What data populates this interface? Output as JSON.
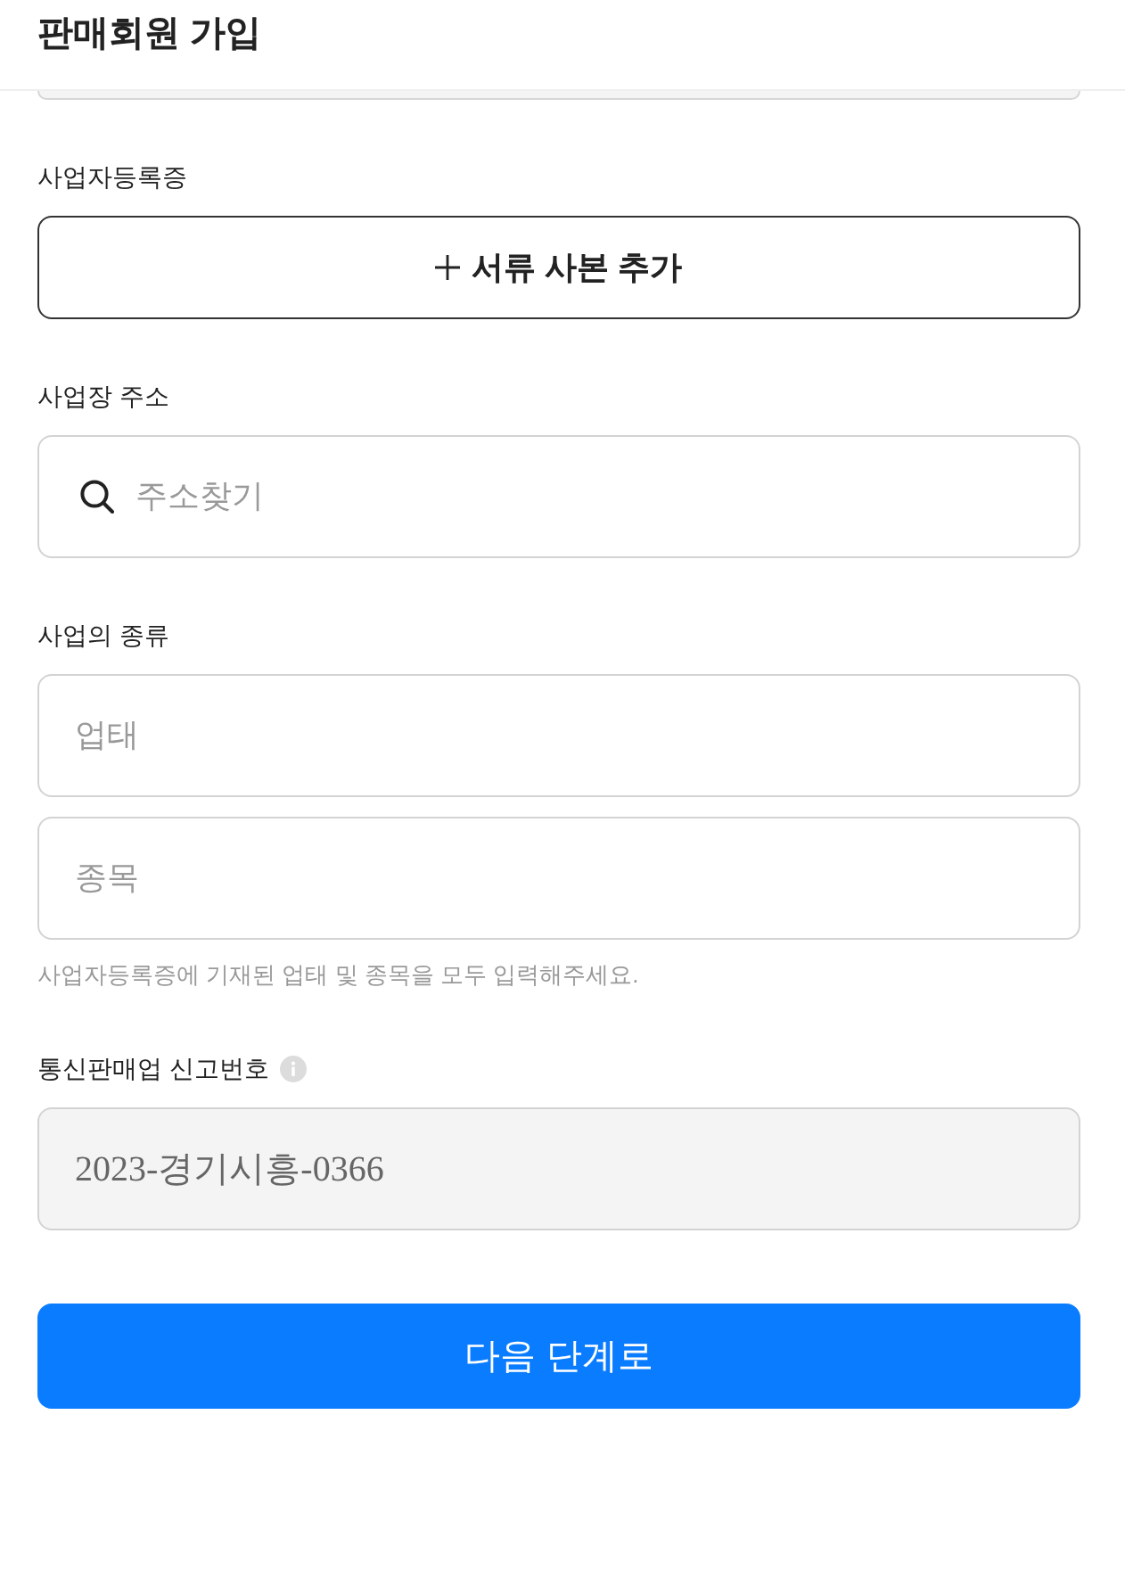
{
  "header": {
    "title": "판매회원 가입"
  },
  "sections": [
    {
      "kind": "clipped"
    },
    {
      "kind": "field",
      "label": "사업자등록증",
      "controls": [
        {
          "kind": "upload",
          "label": "서류 사본 추가"
        }
      ]
    },
    {
      "kind": "field",
      "label": "사업장 주소",
      "controls": [
        {
          "kind": "search",
          "placeholder": "주소찾기"
        }
      ]
    },
    {
      "kind": "field",
      "label": "사업의 종류",
      "controls": [
        {
          "kind": "text",
          "placeholder": "업태",
          "disabled": false
        },
        {
          "kind": "text",
          "placeholder": "종목",
          "disabled": false
        }
      ],
      "hint": "사업자등록증에 기재된 업태 및 종목을 모두 입력해주세요."
    },
    {
      "kind": "field",
      "label": "통신판매업 신고번호",
      "info": true,
      "controls": [
        {
          "kind": "text",
          "value": "2023-경기시흥-0366",
          "disabled": true
        }
      ]
    }
  ],
  "submit": {
    "label": "다음 단계로"
  }
}
